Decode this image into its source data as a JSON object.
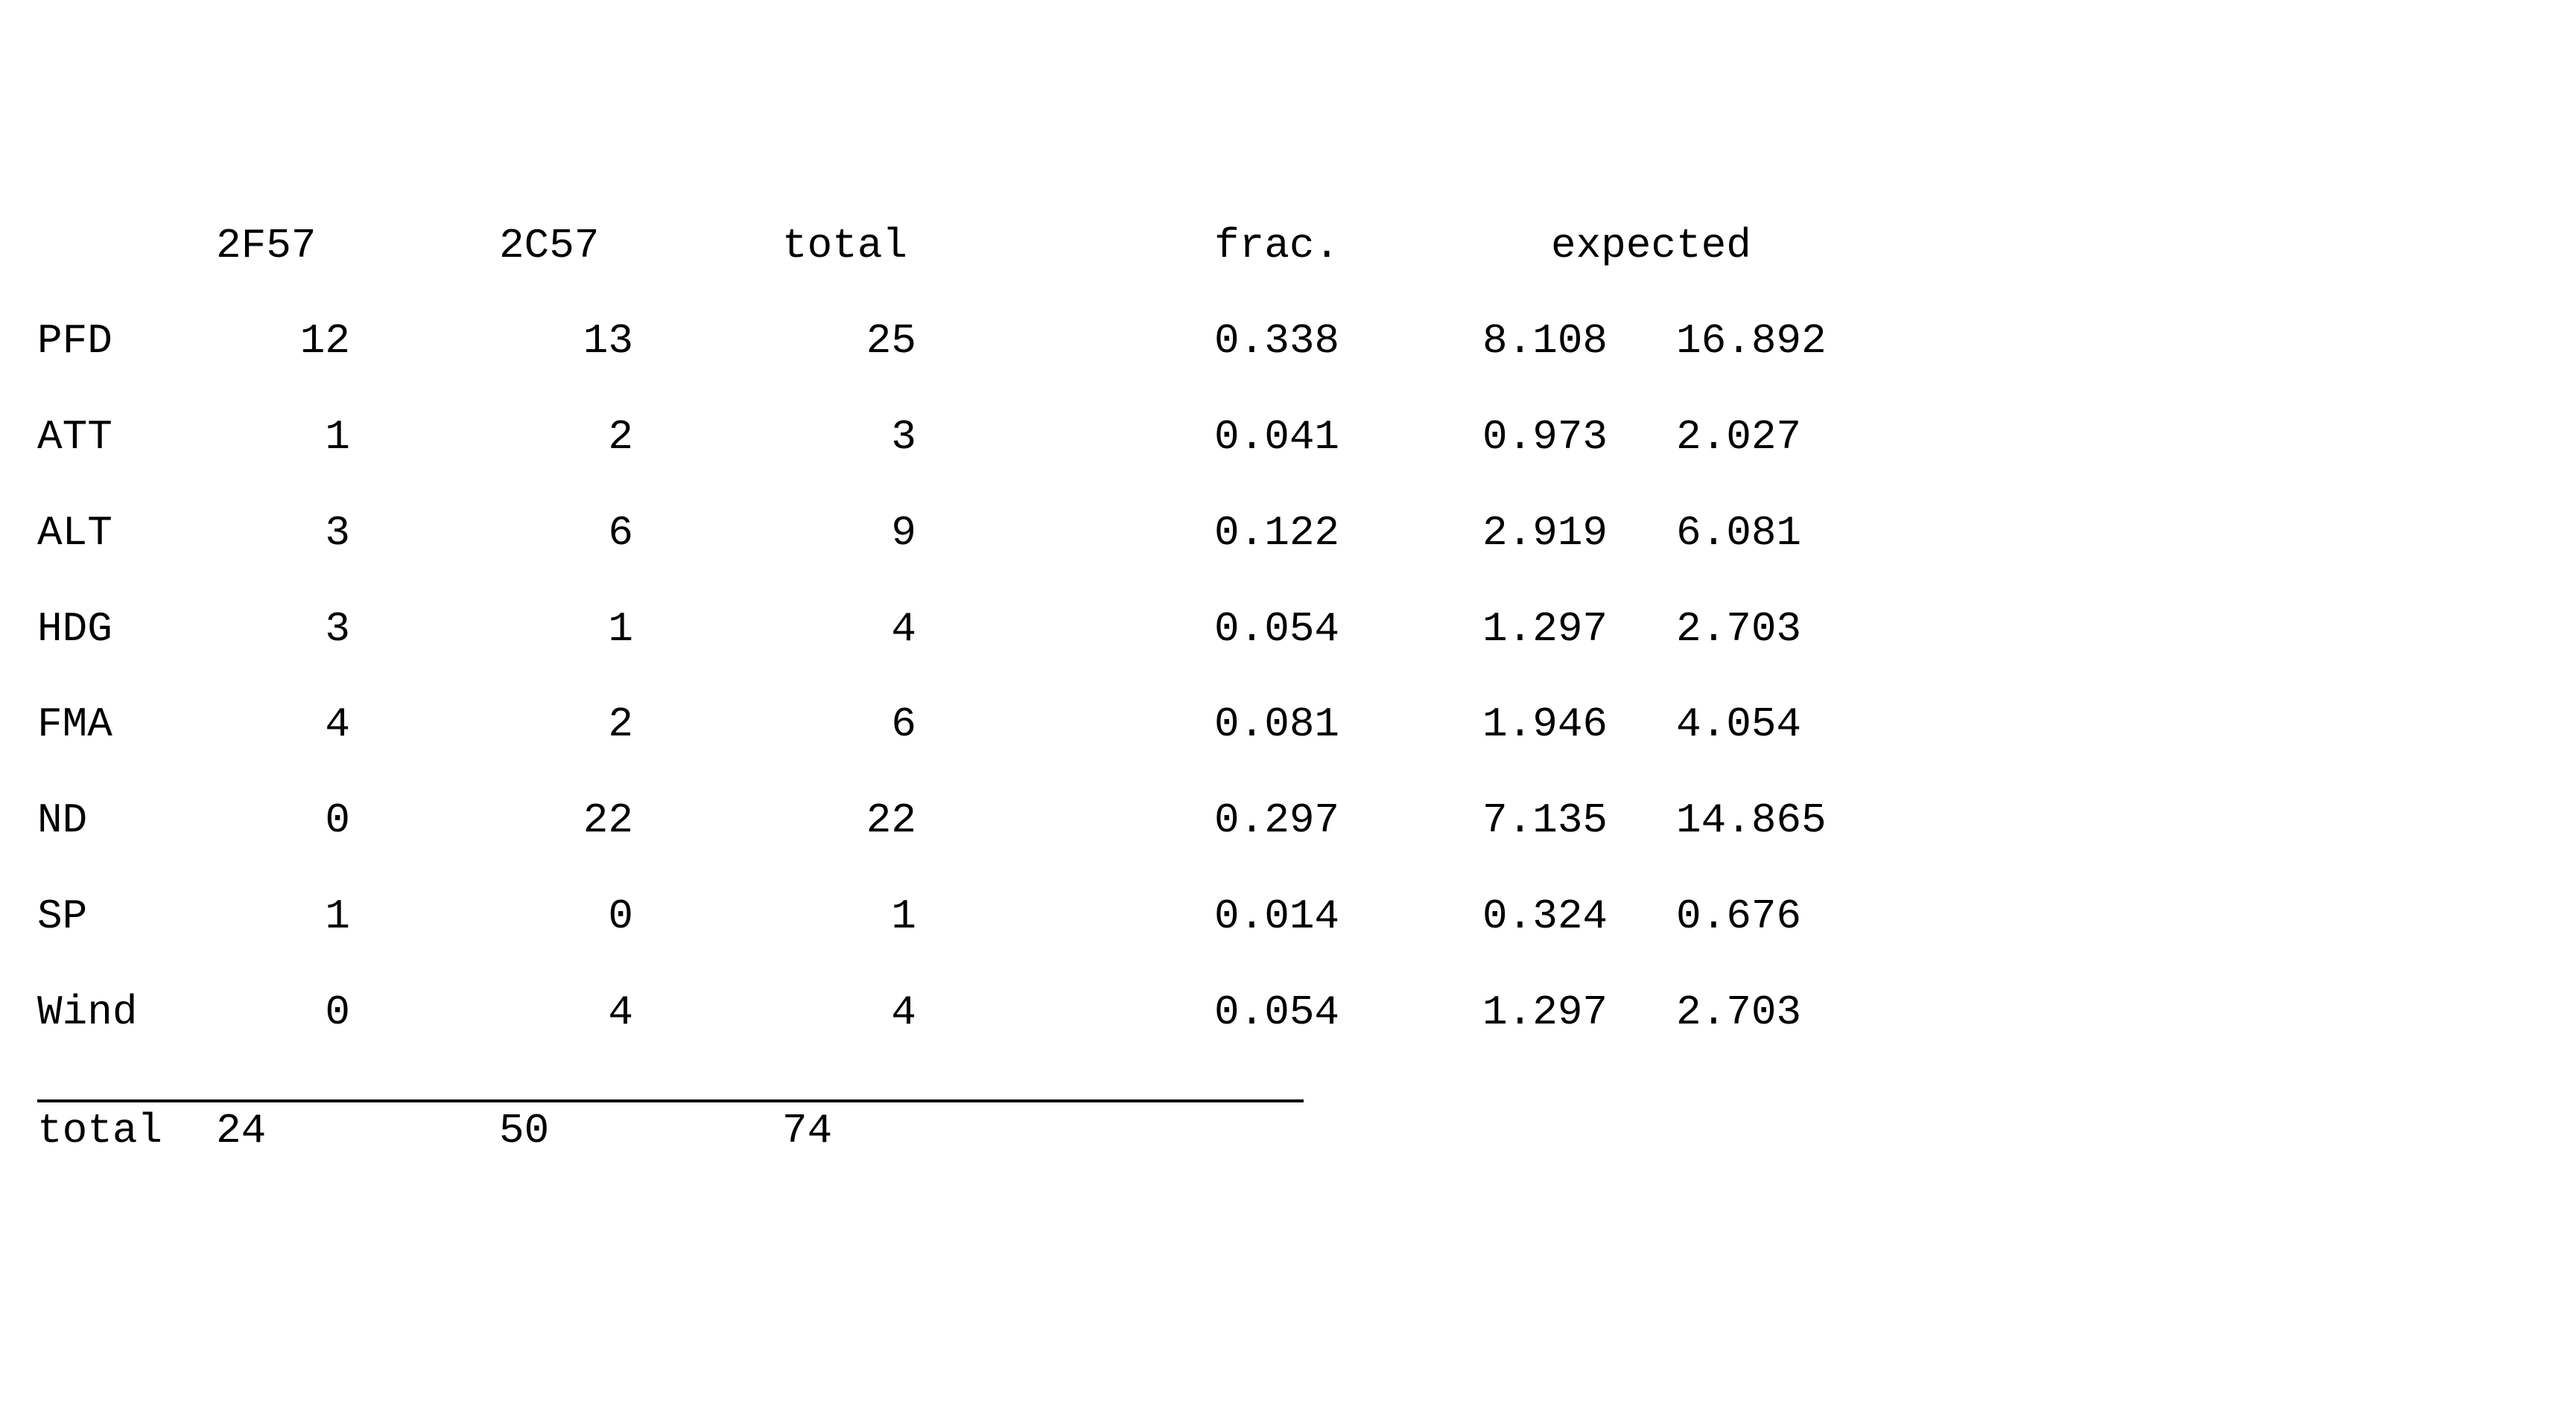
{
  "chart_data": {
    "type": "table",
    "columns": [
      "",
      "2F57",
      "2C57",
      "total",
      "frac.",
      "expected_2F57",
      "expected_2C57"
    ],
    "rows": [
      {
        "label": "PFD",
        "a": 12,
        "b": 13,
        "total": 25,
        "frac": 0.338,
        "exp_a": 8.108,
        "exp_b": 16.892
      },
      {
        "label": "ATT",
        "a": 1,
        "b": 2,
        "total": 3,
        "frac": 0.041,
        "exp_a": 0.973,
        "exp_b": 2.027
      },
      {
        "label": "ALT",
        "a": 3,
        "b": 6,
        "total": 9,
        "frac": 0.122,
        "exp_a": 2.919,
        "exp_b": 6.081
      },
      {
        "label": "HDG",
        "a": 3,
        "b": 1,
        "total": 4,
        "frac": 0.054,
        "exp_a": 1.297,
        "exp_b": 2.703
      },
      {
        "label": "FMA",
        "a": 4,
        "b": 2,
        "total": 6,
        "frac": 0.081,
        "exp_a": 1.946,
        "exp_b": 4.054
      },
      {
        "label": "ND",
        "a": 0,
        "b": 22,
        "total": 22,
        "frac": 0.297,
        "exp_a": 7.135,
        "exp_b": 14.865
      },
      {
        "label": "SP",
        "a": 1,
        "b": 0,
        "total": 1,
        "frac": 0.014,
        "exp_a": 0.324,
        "exp_b": 0.676
      },
      {
        "label": "Wind",
        "a": 0,
        "b": 4,
        "total": 4,
        "frac": 0.054,
        "exp_a": 1.297,
        "exp_b": 2.703
      }
    ],
    "totals": {
      "label": "total",
      "a": 24,
      "b": 50,
      "total": 74
    }
  },
  "header": {
    "blank": "",
    "col_a": "2F57",
    "col_b": "2C57",
    "col_total": "total",
    "col_frac": "frac.",
    "col_expected_left": "expec",
    "col_expected_right": "ted"
  },
  "rows": [
    {
      "label": "PFD",
      "a": "12",
      "b": "13",
      "total": "25",
      "frac": "0.338",
      "exp_a": "8.108",
      "exp_b": "16.892"
    },
    {
      "label": "ATT",
      "a": "1",
      "b": "2",
      "total": "3",
      "frac": "0.041",
      "exp_a": "0.973",
      "exp_b": "2.027"
    },
    {
      "label": "ALT",
      "a": "3",
      "b": "6",
      "total": "9",
      "frac": "0.122",
      "exp_a": "2.919",
      "exp_b": "6.081"
    },
    {
      "label": "HDG",
      "a": "3",
      "b": "1",
      "total": "4",
      "frac": "0.054",
      "exp_a": "1.297",
      "exp_b": "2.703"
    },
    {
      "label": "FMA",
      "a": "4",
      "b": "2",
      "total": "6",
      "frac": "0.081",
      "exp_a": "1.946",
      "exp_b": "4.054"
    },
    {
      "label": "ND",
      "a": "0",
      "b": "22",
      "total": "22",
      "frac": "0.297",
      "exp_a": "7.135",
      "exp_b": "14.865"
    },
    {
      "label": "SP",
      "a": "1",
      "b": "0",
      "total": "1",
      "frac": "0.014",
      "exp_a": "0.324",
      "exp_b": "0.676"
    },
    {
      "label": "Wind",
      "a": "0",
      "b": "4",
      "total": "4",
      "frac": "0.054",
      "exp_a": "1.297",
      "exp_b": "2.703"
    }
  ],
  "footer": {
    "label": "total",
    "a": "24",
    "b": "50",
    "total": "74"
  }
}
